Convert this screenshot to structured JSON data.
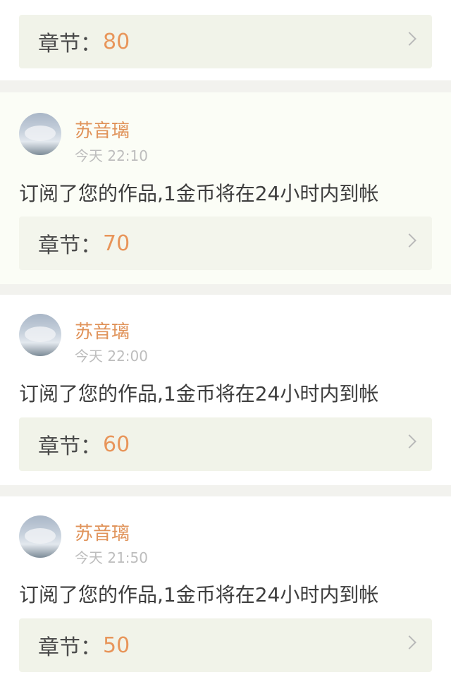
{
  "top_item": {
    "chapter_label": "章节：",
    "chapter_value": "80"
  },
  "items": [
    {
      "username": "苏音璃",
      "time": "今天 22:10",
      "message": "订阅了您的作品,1金币将在24小时内到帐",
      "chapter_label": "章节：",
      "chapter_value": "70"
    },
    {
      "username": "苏音璃",
      "time": "今天 22:00",
      "message": "订阅了您的作品,1金币将在24小时内到帐",
      "chapter_label": "章节：",
      "chapter_value": "60"
    },
    {
      "username": "苏音璃",
      "time": "今天 21:50",
      "message": "订阅了您的作品,1金币将在24小时内到帐",
      "chapter_label": "章节：",
      "chapter_value": "50"
    }
  ],
  "colors": {
    "accent": "#e8955a",
    "tab_indicator": "#e07aa0",
    "row_bg": "#f1f3e9"
  }
}
